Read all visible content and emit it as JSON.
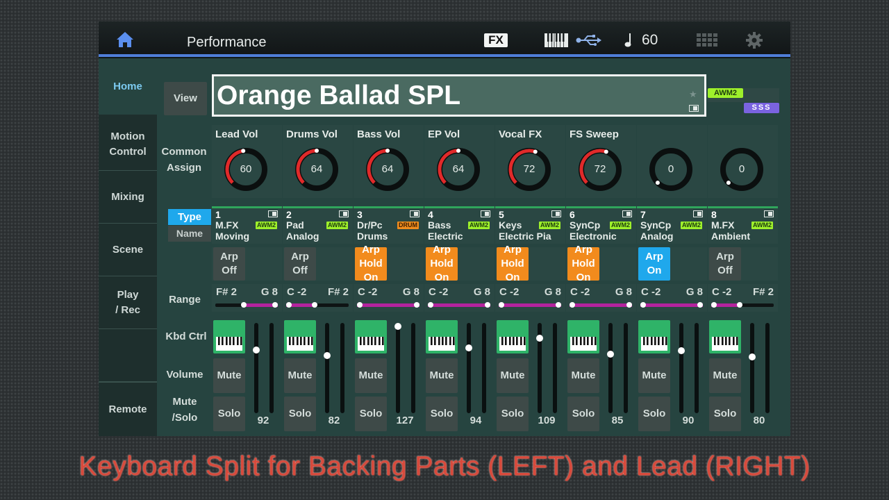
{
  "header": {
    "title": "Performance",
    "fx_label": "FX",
    "tempo": "60"
  },
  "sidebar": {
    "items": [
      {
        "label": "Home",
        "active": true
      },
      {
        "label": "Motion\nControl"
      },
      {
        "label": "Mixing"
      },
      {
        "label": "Scene"
      },
      {
        "label": "Play\n/ Rec"
      },
      {
        "label": ""
      },
      {
        "label": "Remote"
      }
    ]
  },
  "view_button": "View",
  "performance_name": "Orange Ballad SPL",
  "badges": {
    "awm2": "AWM2",
    "sss": "SSS"
  },
  "row_labels": {
    "common_assign": "Common\nAssign",
    "type": "Type",
    "name": "Name",
    "range": "Range",
    "kbd_ctrl": "Kbd Ctrl",
    "volume": "Volume",
    "mute_solo": "Mute\n/Solo"
  },
  "knobs": [
    {
      "name": "Lead Vol",
      "value": "60",
      "level": 0.47
    },
    {
      "name": "Drums Vol",
      "value": "64",
      "level": 0.5
    },
    {
      "name": "Bass Vol",
      "value": "64",
      "level": 0.5
    },
    {
      "name": "EP Vol",
      "value": "64",
      "level": 0.5
    },
    {
      "name": "Vocal FX",
      "value": "72",
      "level": 0.57
    },
    {
      "name": "FS Sweep",
      "value": "72",
      "level": 0.57
    },
    {
      "name": "",
      "value": "0",
      "level": 0
    },
    {
      "name": "",
      "value": "0",
      "level": 0
    }
  ],
  "parts": [
    {
      "number": "1",
      "line1": "M.FX",
      "line2": "Moving",
      "badge": "AWM2",
      "arp": "Arp\nOff",
      "arp_state": "off",
      "range_low": "F# 2",
      "range_high": "G 8",
      "range_from": 0.45,
      "range_to": 1,
      "mute": "Mute",
      "solo": "Solo",
      "volume": "92",
      "volume_level": 0.72
    },
    {
      "number": "2",
      "line1": "Pad",
      "line2": "Analog",
      "badge": "AWM2",
      "arp": "Arp\nOff",
      "arp_state": "off",
      "range_low": "C -2",
      "range_high": "F# 2",
      "range_from": 0,
      "range_to": 0.45,
      "mute": "Mute",
      "solo": "Solo",
      "volume": "82",
      "volume_level": 0.65
    },
    {
      "number": "3",
      "line1": "Dr/Pc",
      "line2": "Drums",
      "badge": "DRUM",
      "arp": "Arp\nHold\nOn",
      "arp_state": "hold",
      "range_low": "C -2",
      "range_high": "G 8",
      "range_from": 0,
      "range_to": 1,
      "mute": "Mute",
      "solo": "Solo",
      "volume": "127",
      "volume_level": 1
    },
    {
      "number": "4",
      "line1": "Bass",
      "line2": "Electric",
      "badge": "AWM2",
      "arp": "Arp\nHold\nOn",
      "arp_state": "hold",
      "range_low": "C -2",
      "range_high": "G 8",
      "range_from": 0,
      "range_to": 1,
      "mute": "Mute",
      "solo": "Solo",
      "volume": "94",
      "volume_level": 0.74
    },
    {
      "number": "5",
      "line1": "Keys",
      "line2": "Electric Pia",
      "badge": "AWM2",
      "arp": "Arp\nHold\nOn",
      "arp_state": "hold",
      "range_low": "C -2",
      "range_high": "G 8",
      "range_from": 0,
      "range_to": 1,
      "mute": "Mute",
      "solo": "Solo",
      "volume": "109",
      "volume_level": 0.86
    },
    {
      "number": "6",
      "line1": "SynCp",
      "line2": "Electronic",
      "badge": "AWM2",
      "arp": "Arp\nHold\nOn",
      "arp_state": "hold",
      "range_low": "C -2",
      "range_high": "G 8",
      "range_from": 0,
      "range_to": 1,
      "mute": "Mute",
      "solo": "Solo",
      "volume": "85",
      "volume_level": 0.67
    },
    {
      "number": "7",
      "line1": "SynCp",
      "line2": "Analog",
      "badge": "AWM2",
      "arp": "Arp\nOn",
      "arp_state": "on",
      "range_low": "C -2",
      "range_high": "G 8",
      "range_from": 0,
      "range_to": 1,
      "mute": "Mute",
      "solo": "Solo",
      "volume": "90",
      "volume_level": 0.71
    },
    {
      "number": "8",
      "line1": "M.FX",
      "line2": "Ambient",
      "badge": "AWM2",
      "arp": "Arp\nOff",
      "arp_state": "off",
      "range_low": "C -2",
      "range_high": "F# 2",
      "range_from": 0,
      "range_to": 0.45,
      "mute": "Mute",
      "solo": "Solo",
      "volume": "80",
      "volume_level": 0.63
    }
  ],
  "caption": "Keyboard Split for Backing Parts (LEFT) and Lead (RIGHT)",
  "colors": {
    "accent_blue": "#4f7ed8",
    "panel_bg": "#264440",
    "arp_hold": "#f28b1d",
    "arp_on": "#1fa8ec",
    "awm2_badge": "#9ef02b",
    "drum_badge": "#ef8c1d",
    "knob_red": "#e02a2a",
    "range_fill": "#b4239e",
    "kbd_green": "#2fb368"
  }
}
